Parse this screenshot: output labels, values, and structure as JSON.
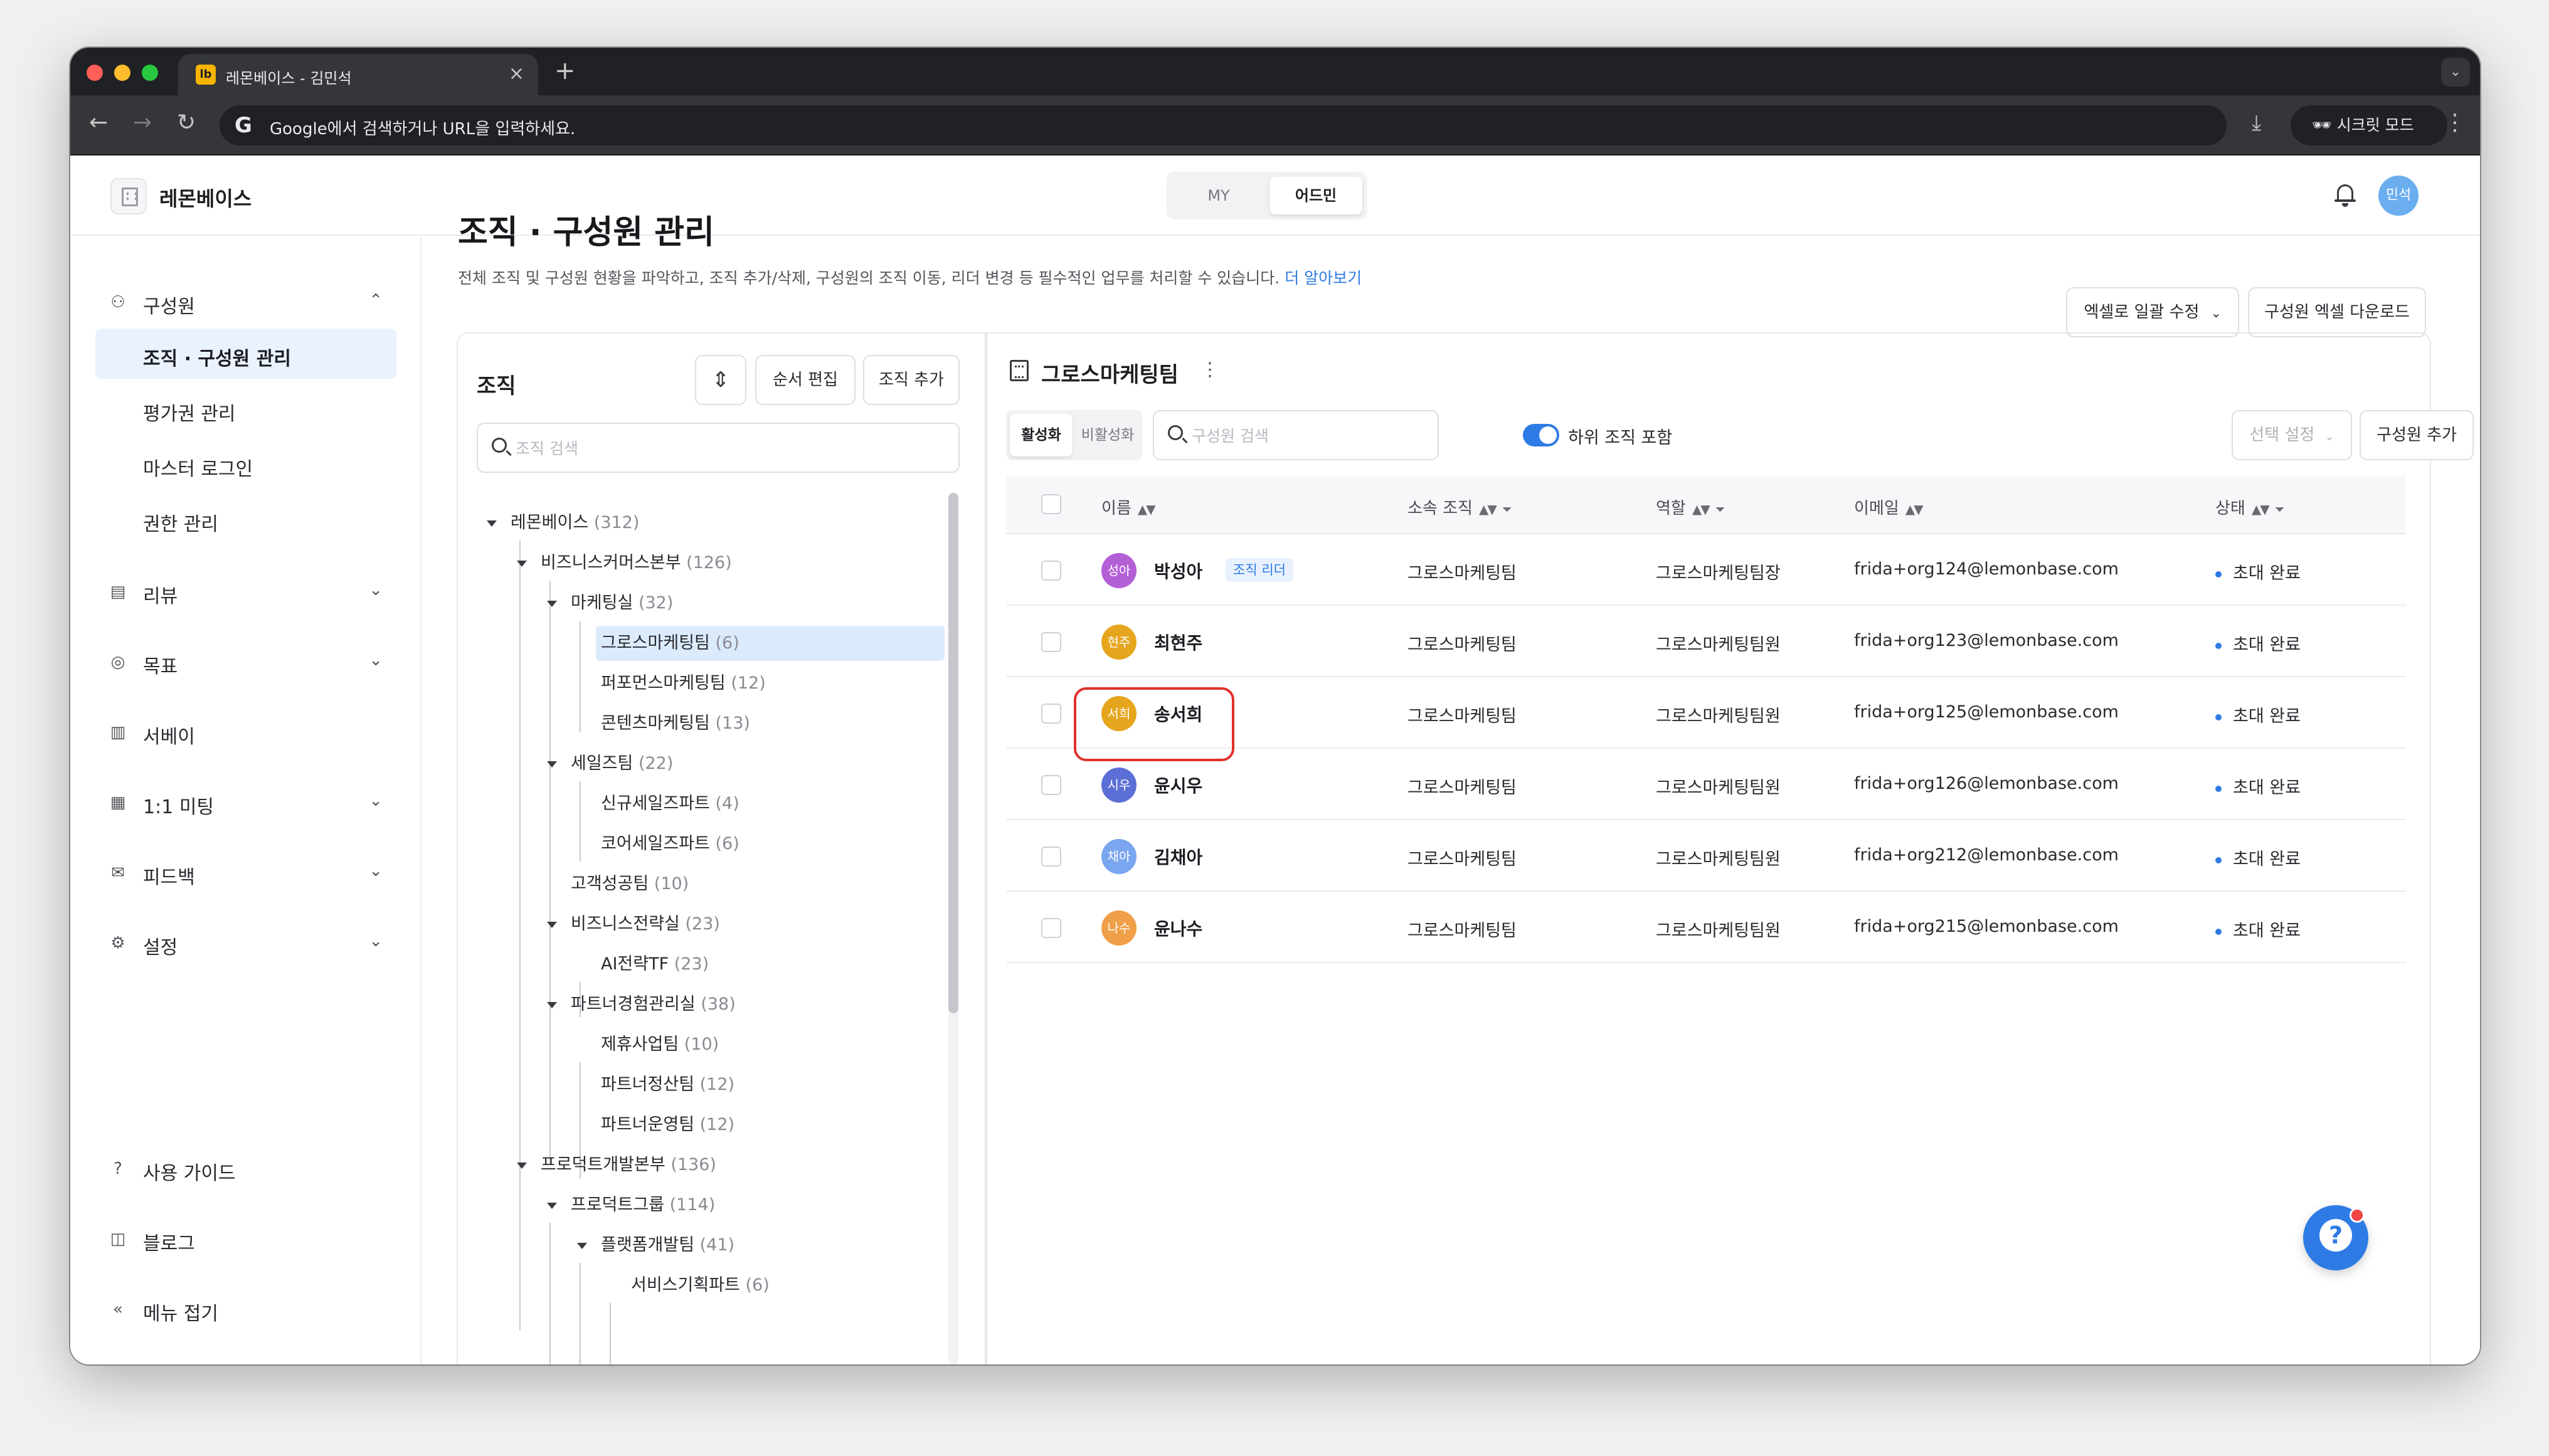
{
  "browser": {
    "tab_title": "레몬베이스 - 김민석",
    "tab_favicon": "lb",
    "omnibox_placeholder": "Google에서 검색하거나 URL을 입력하세요.",
    "incognito_label": "시크릿 모드"
  },
  "header": {
    "brand": "레몬베이스",
    "mode_my": "MY",
    "mode_admin": "어드민",
    "avatar_initials": "민석"
  },
  "sidebar": {
    "group_members": "구성원",
    "sub_items": [
      "조직 · 구성원 관리",
      "평가권 관리",
      "마스터 로그인",
      "권한 관리"
    ],
    "items": [
      "리뷰",
      "목표",
      "서베이",
      "1:1 미팅",
      "피드백",
      "설정"
    ],
    "footer": [
      "사용 가이드",
      "블로그",
      "메뉴 접기"
    ]
  },
  "page": {
    "title": "조직 · 구성원 관리",
    "description": "전체 조직 및 구성원 현황을 파악하고, 조직 추가/삭제, 구성원의 조직 이동, 리더 변경 등 필수적인 업무를 처리할 수 있습니다.",
    "learn_more": "더 알아보기",
    "excel_bulk_edit": "엑셀로 일괄 수정",
    "excel_download": "구성원 엑셀 다운로드"
  },
  "org_panel": {
    "heading": "조직",
    "reorder": "순서 편집",
    "add_org": "조직 추가",
    "search_placeholder": "조직 검색",
    "tree": [
      {
        "name": "레몬베이스",
        "count": "(312)"
      },
      {
        "name": "비즈니스커머스본부",
        "count": "(126)"
      },
      {
        "name": "마케팅실",
        "count": "(32)"
      },
      {
        "name": "그로스마케팅팀",
        "count": "(6)"
      },
      {
        "name": "퍼포먼스마케팅팀",
        "count": "(12)"
      },
      {
        "name": "콘텐츠마케팅팀",
        "count": "(13)"
      },
      {
        "name": "세일즈팀",
        "count": "(22)"
      },
      {
        "name": "신규세일즈파트",
        "count": "(4)"
      },
      {
        "name": "코어세일즈파트",
        "count": "(6)"
      },
      {
        "name": "고객성공팀",
        "count": "(10)"
      },
      {
        "name": "비즈니스전략실",
        "count": "(23)"
      },
      {
        "name": "AI전략TF",
        "count": "(23)"
      },
      {
        "name": "파트너경험관리실",
        "count": "(38)"
      },
      {
        "name": "제휴사업팀",
        "count": "(10)"
      },
      {
        "name": "파트너정산팀",
        "count": "(12)"
      },
      {
        "name": "파트너운영팀",
        "count": "(12)"
      },
      {
        "name": "프로덕트개발본부",
        "count": "(136)"
      },
      {
        "name": "프로덕트그룹",
        "count": "(114)"
      },
      {
        "name": "플랫폼개발팀",
        "count": "(41)"
      },
      {
        "name": "서비스기획파트",
        "count": "(6)"
      }
    ]
  },
  "member_panel": {
    "team_name": "그로스마케팅팀",
    "tab_active": "활성화",
    "tab_inactive": "비활성화",
    "search_placeholder": "구성원 검색",
    "include_sub_orgs": "하위 조직 포함",
    "select_settings": "선택 설정",
    "add_member": "구성원 추가",
    "columns": [
      "이름",
      "소속 조직",
      "역할",
      "이메일",
      "상태"
    ],
    "leader_badge": "조직 리더",
    "rows": [
      {
        "initials": "성아",
        "name": "박성아",
        "org": "그로스마케팅팀",
        "role": "그로스마케팅팀장",
        "email": "frida+org124@lemonbase.com",
        "status": "초대 완료",
        "color": "#b35fd6"
      },
      {
        "initials": "현주",
        "name": "최현주",
        "org": "그로스마케팅팀",
        "role": "그로스마케팅팀원",
        "email": "frida+org123@lemonbase.com",
        "status": "초대 완료",
        "color": "#e5a51d"
      },
      {
        "initials": "서희",
        "name": "송서희",
        "org": "그로스마케팅팀",
        "role": "그로스마케팅팀원",
        "email": "frida+org125@lemonbase.com",
        "status": "초대 완료",
        "color": "#e5a51d"
      },
      {
        "initials": "시우",
        "name": "윤시우",
        "org": "그로스마케팅팀",
        "role": "그로스마케팅팀원",
        "email": "frida+org126@lemonbase.com",
        "status": "초대 완료",
        "color": "#5b6fd6"
      },
      {
        "initials": "채아",
        "name": "김채아",
        "org": "그로스마케팅팀",
        "role": "그로스마케팅팀원",
        "email": "frida+org212@lemonbase.com",
        "status": "초대 완료",
        "color": "#7aa6f0"
      },
      {
        "initials": "나수",
        "name": "윤나수",
        "org": "그로스마케팅팀",
        "role": "그로스마케팅팀원",
        "email": "frida+org215@lemonbase.com",
        "status": "초대 완료",
        "color": "#f0a048"
      }
    ]
  },
  "colors": {
    "accent": "#2f7be5",
    "highlight": "#e0312b"
  }
}
